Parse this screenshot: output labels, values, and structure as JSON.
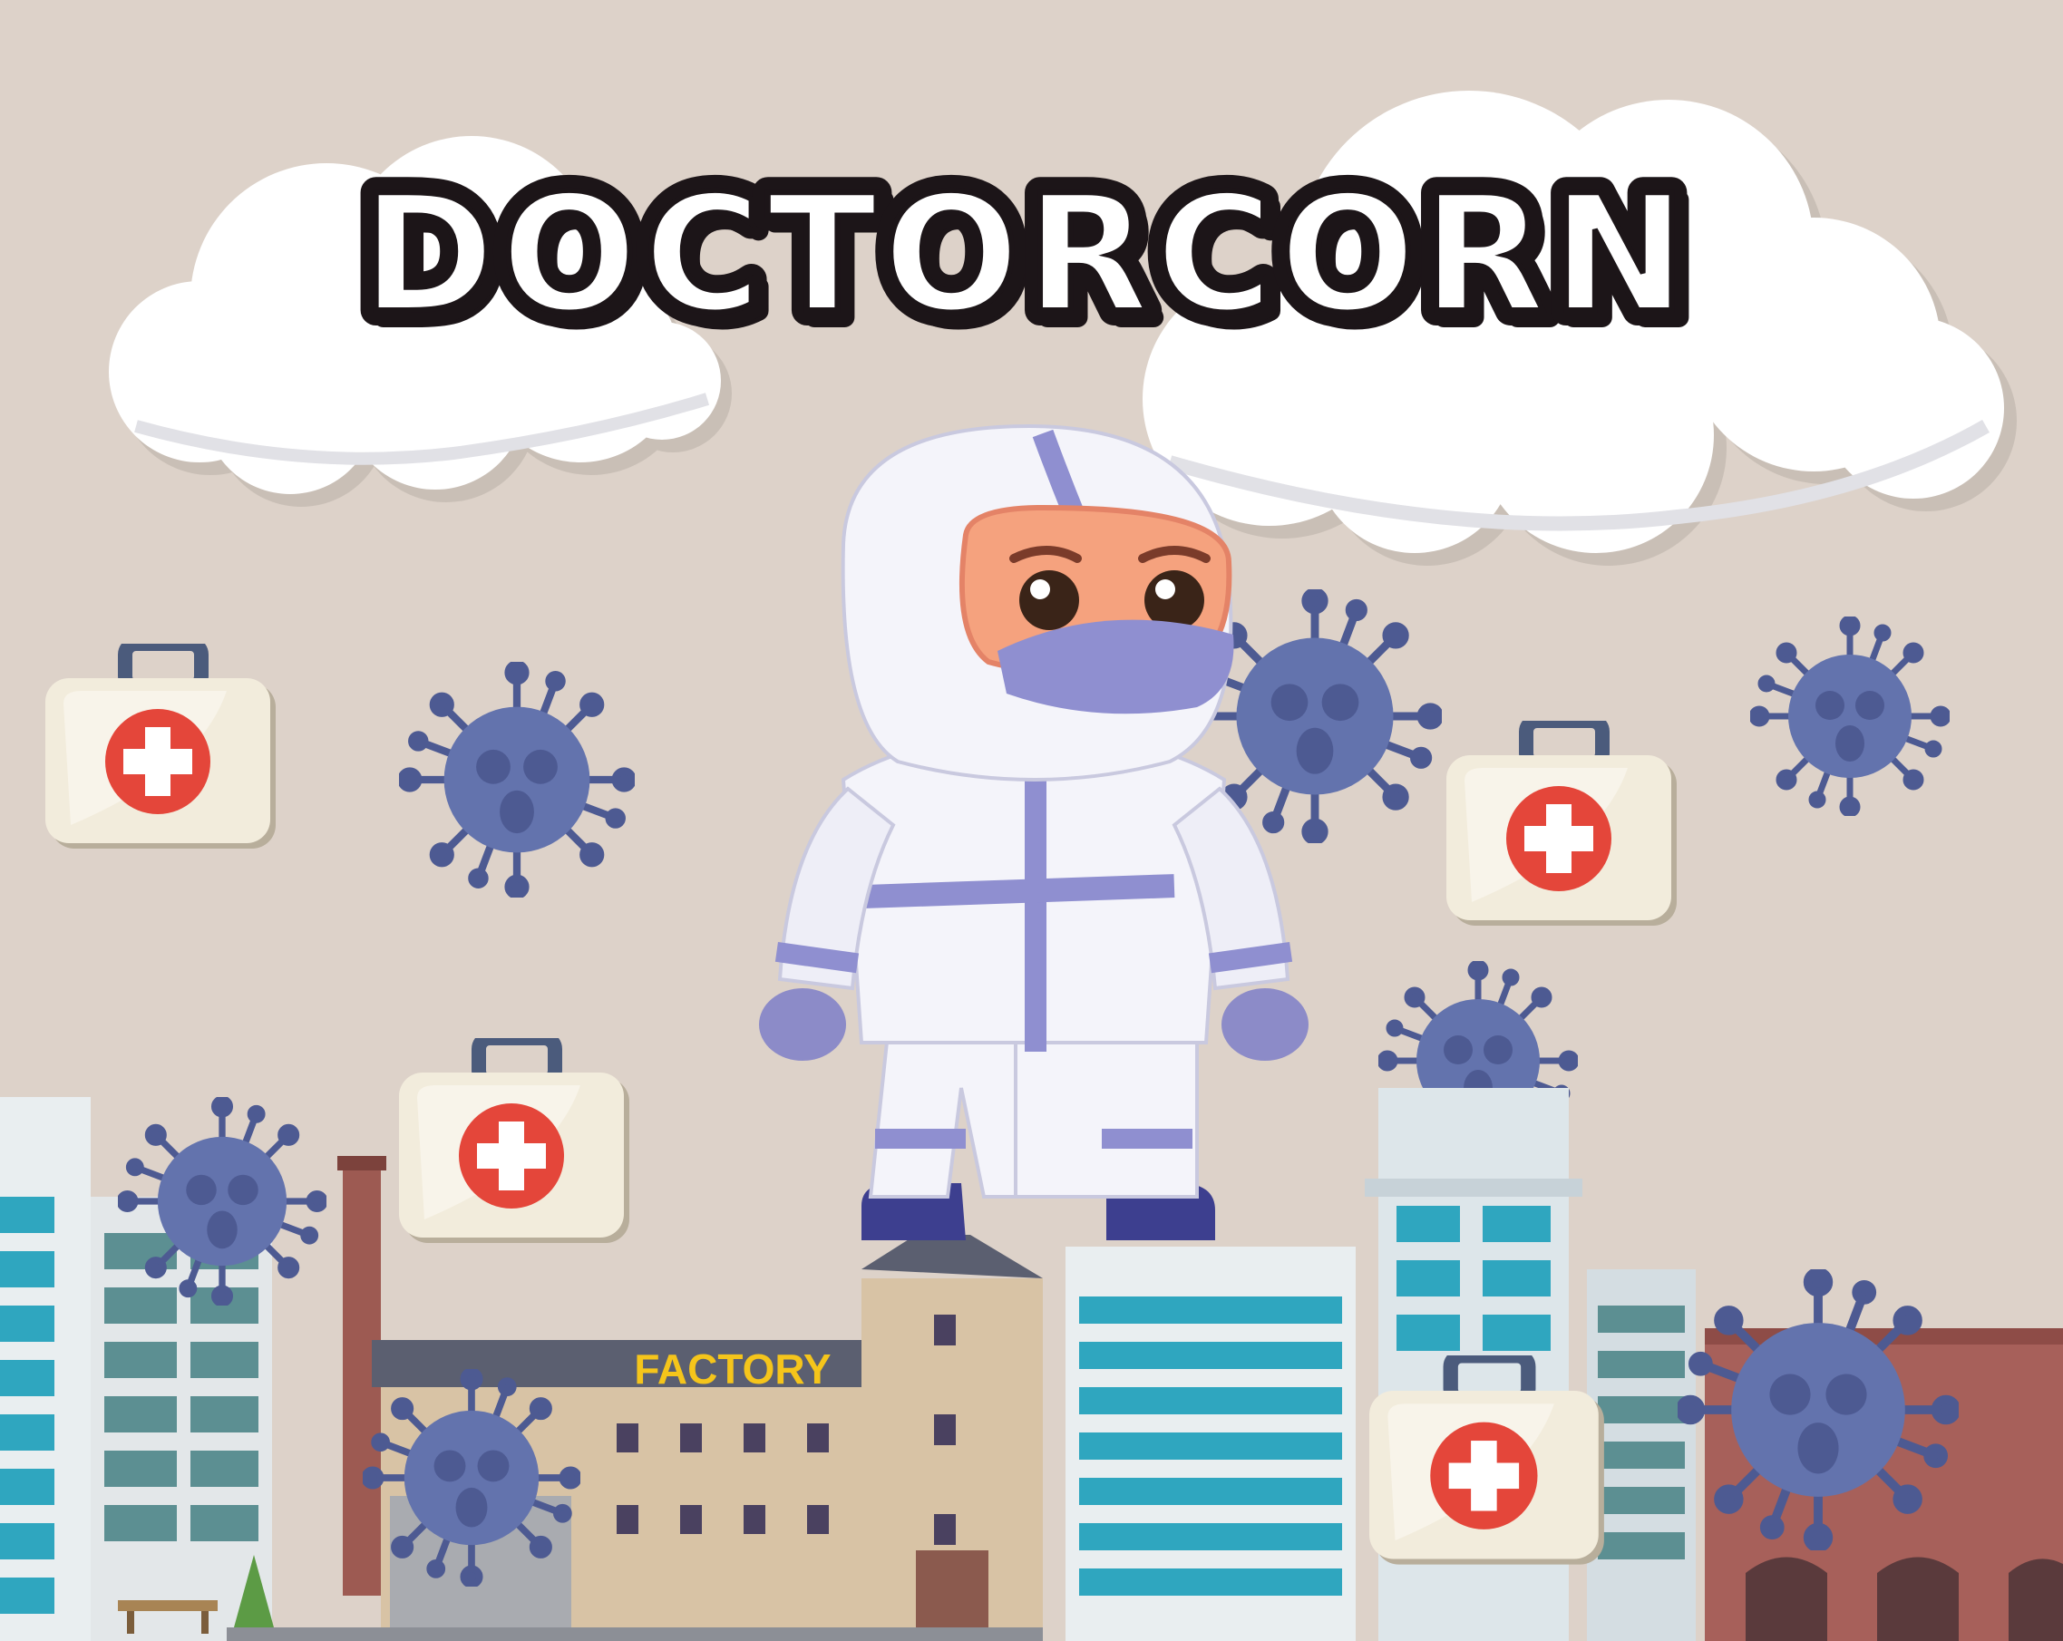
{
  "title": "DOCTORCORN",
  "factory_sign": "FACTORY",
  "colors": {
    "background": "#ddd2c9",
    "cloud": "#ffffff",
    "virus": "#5f6ea8",
    "suit": "#f4f4fa",
    "suit_stripe": "#8f8fd0",
    "medkit": "#f2ecdc",
    "medkit_cross_bg": "#e4463a",
    "glass": "#2fa6bf",
    "brick": "#a7605a",
    "factory_wall": "#d8c3a5",
    "factory_sign": "#f5c51b"
  },
  "icons": [
    "cloud-icon",
    "virus-icon",
    "medkit-icon",
    "doctor-character",
    "building-icon"
  ]
}
